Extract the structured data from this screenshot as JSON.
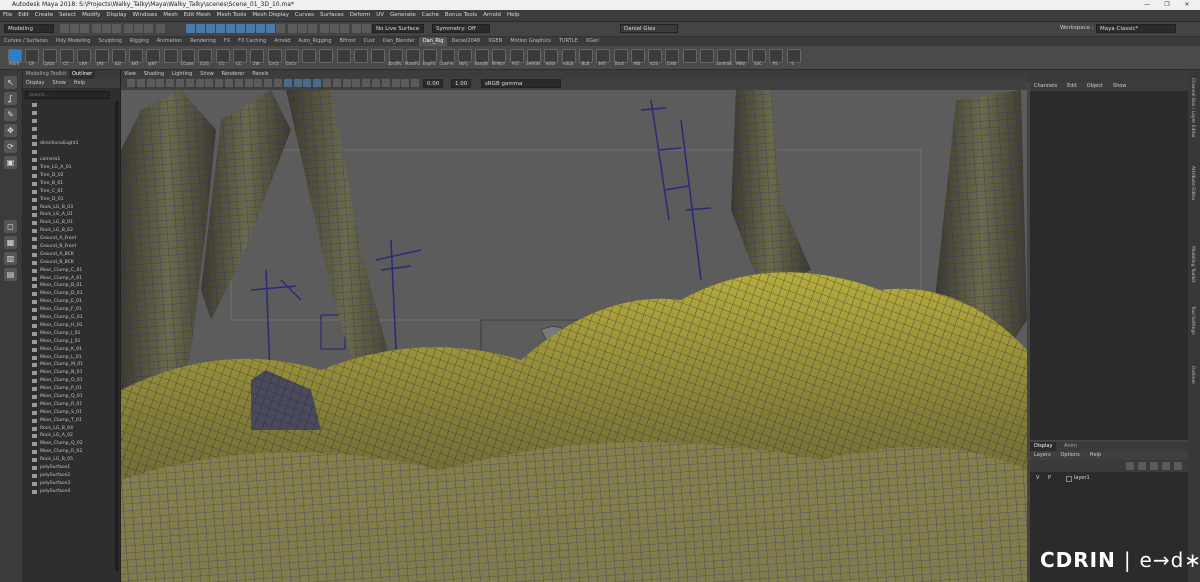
{
  "window": {
    "title": "Autodesk Maya 2018: S:\\Projects\\Walky_Talky\\Maya\\Walky_Talky\\scenes\\Scene_01_3D_10.ma*",
    "buttons": [
      "—",
      "❐",
      "✕"
    ]
  },
  "menubar": {
    "items": [
      "File",
      "Edit",
      "Create",
      "Select",
      "Modify",
      "Display",
      "Windows",
      "Mesh",
      "Edit Mesh",
      "Mesh Tools",
      "Mesh Display",
      "Curves",
      "Surfaces",
      "Deform",
      "UV",
      "Generate",
      "Cache",
      "Bonus Tools",
      "Arnold",
      "Help"
    ]
  },
  "statusline": {
    "mode": "Modeling",
    "live_surface": "No Live Surface",
    "symmetry": "Symmetry: Off",
    "user": "Daniel Gies",
    "workspace_label": "Workspace :",
    "workspace_value": "Maya Classic*"
  },
  "shelf": {
    "tabs": [
      "Curves / Surfaces",
      "Poly Modeling",
      "Sculpting",
      "Rigging",
      "Animation",
      "Rendering",
      "FX",
      "FX Caching",
      "Arnold",
      "Auto_Rigging",
      "Bifrost",
      "Cust",
      "Dan_Blender",
      "Dan_Rig",
      "Daniel2048",
      "XGEN",
      "Motion Graphics",
      "TURTLE",
      "XGen"
    ],
    "active_tab": "Dan_Rig",
    "icons": [
      {
        "label": "Anim",
        "color": "#2c7fc9"
      },
      {
        "label": "CP",
        "color": "#3b3b3b"
      },
      {
        "label": "CpGd",
        "color": "#3b3b3b"
      },
      {
        "label": "CC",
        "color": "#3b3b3b"
      },
      {
        "label": "LRA",
        "color": "#3b3b3b"
      },
      {
        "label": "JAS",
        "color": "#3b3b3b"
      },
      {
        "label": "ILB",
        "color": "#3b3b3b"
      },
      {
        "label": "EKT",
        "color": "#3b3b3b"
      },
      {
        "label": "xJNT",
        "color": "#3b3b3b"
      },
      {
        "label": "",
        "color": "#3b3b3b"
      },
      {
        "label": "CCube",
        "color": "#3b3b3b"
      },
      {
        "label": "COG",
        "color": "#3b3b3b"
      },
      {
        "label": "CC",
        "color": "#3b3b3b"
      },
      {
        "label": "CC",
        "color": "#3b3b3b"
      },
      {
        "label": "2W",
        "color": "#3b3b3b"
      },
      {
        "label": "CirCt",
        "color": "#3b3b3b"
      },
      {
        "label": "CirCs",
        "color": "#3b3b3b"
      },
      {
        "label": "",
        "color": "#3b3b3b"
      },
      {
        "label": "",
        "color": "#3b3b3b"
      },
      {
        "label": "",
        "color": "#3b3b3b"
      },
      {
        "label": "",
        "color": "#3b3b3b"
      },
      {
        "label": "",
        "color": "#3b3b3b"
      },
      {
        "label": "dbrSPL",
        "color": "#3b3b3b"
      },
      {
        "label": "MarkFG",
        "color": "#3b3b3b"
      },
      {
        "label": "ExpFG",
        "color": "#3b3b3b"
      },
      {
        "label": "ConFm",
        "color": "#3b3b3b"
      },
      {
        "label": "INFC",
        "color": "#3b3b3b"
      },
      {
        "label": "RamJN",
        "color": "#3b3b3b"
      },
      {
        "label": "RFMclr",
        "color": "#3b3b3b"
      },
      {
        "label": "PST",
        "color": "#3b3b3b"
      },
      {
        "label": "SHPGN",
        "color": "#3b3b3b"
      },
      {
        "label": "HSW",
        "color": "#3b3b3b"
      },
      {
        "label": "+BLB",
        "color": "#3b3b3b"
      },
      {
        "label": "-BLB",
        "color": "#3b3b3b"
      },
      {
        "label": "EAT",
        "color": "#3b3b3b"
      },
      {
        "label": "BlnX",
        "color": "#3b3b3b"
      },
      {
        "label": "AIB",
        "color": "#3b3b3b"
      },
      {
        "label": "K2S",
        "color": "#3b3b3b"
      },
      {
        "label": "CVW",
        "color": "#3b3b3b"
      },
      {
        "label": "",
        "color": "#3b3b3b"
      },
      {
        "label": "",
        "color": "#3b3b3b"
      },
      {
        "label": "SmthSK",
        "color": "#3b3b3b"
      },
      {
        "label": "PBW",
        "color": "#3b3b3b"
      },
      {
        "label": "SSC",
        "color": "#3b3b3b"
      },
      {
        "label": "PS",
        "color": "#3b3b3b"
      },
      {
        "label": "S",
        "color": "#3b3b3b"
      }
    ]
  },
  "outliner": {
    "tabs": [
      "Modeling Toolkit",
      "Outliner"
    ],
    "active_tab": "Outliner",
    "menu": [
      "Display",
      "Show",
      "Help"
    ],
    "search_placeholder": "Search...",
    "items": [
      {
        "name": "",
        "dim": true
      },
      {
        "name": "",
        "dim": true
      },
      {
        "name": "",
        "dim": true
      },
      {
        "name": "",
        "dim": true
      },
      {
        "name": "",
        "dim": true
      },
      {
        "name": "directionalLight1",
        "dim": false
      },
      {
        "name": "",
        "dim": true
      },
      {
        "name": "camera1",
        "dim": false
      },
      {
        "name": "Tree_LG_A_01",
        "dim": false
      },
      {
        "name": "Tree_D_02",
        "dim": false
      },
      {
        "name": "Tree_B_01",
        "dim": false
      },
      {
        "name": "Tree_C_01",
        "dim": false
      },
      {
        "name": "Tree_D_01",
        "dim": false
      },
      {
        "name": "Rock_LG_B_03",
        "dim": false
      },
      {
        "name": "Rock_LG_A_01",
        "dim": false
      },
      {
        "name": "Rock_LG_B_01",
        "dim": false
      },
      {
        "name": "Rock_LG_B_02",
        "dim": false
      },
      {
        "name": "Ground_A_Front",
        "dim": false
      },
      {
        "name": "Ground_B_Front",
        "dim": false
      },
      {
        "name": "Ground_A_BCK",
        "dim": false
      },
      {
        "name": "Ground_B_BCK",
        "dim": false
      },
      {
        "name": "Moss_Clump_C_01",
        "dim": false
      },
      {
        "name": "Moss_Clump_A_01",
        "dim": false
      },
      {
        "name": "Moss_Clump_B_01",
        "dim": false
      },
      {
        "name": "Moss_Clump_D_01",
        "dim": false
      },
      {
        "name": "Moss_Clump_E_01",
        "dim": false
      },
      {
        "name": "Moss_Clump_F_01",
        "dim": false
      },
      {
        "name": "Moss_Clump_G_01",
        "dim": false
      },
      {
        "name": "Moss_Clump_H_01",
        "dim": false
      },
      {
        "name": "Moss_Clump_I_01",
        "dim": false
      },
      {
        "name": "Moss_Clump_J_01",
        "dim": false
      },
      {
        "name": "Moss_Clump_K_01",
        "dim": false
      },
      {
        "name": "Moss_Clump_L_01",
        "dim": false
      },
      {
        "name": "Moss_Clump_M_01",
        "dim": false
      },
      {
        "name": "Moss_Clump_N_01",
        "dim": false
      },
      {
        "name": "Moss_Clump_O_01",
        "dim": false
      },
      {
        "name": "Moss_Clump_P_01",
        "dim": false
      },
      {
        "name": "Moss_Clump_Q_01",
        "dim": false
      },
      {
        "name": "Moss_Clump_R_01",
        "dim": false
      },
      {
        "name": "Moss_Clump_S_01",
        "dim": false
      },
      {
        "name": "Moss_Clump_T_01",
        "dim": false
      },
      {
        "name": "Rock_LG_B_04",
        "dim": false
      },
      {
        "name": "Rock_LG_A_02",
        "dim": false
      },
      {
        "name": "Moss_Clump_Q_02",
        "dim": false
      },
      {
        "name": "Moss_Clump_R_02",
        "dim": false
      },
      {
        "name": "Rock_LG_B_05",
        "dim": false
      },
      {
        "name": "polySurface1",
        "dim": false
      },
      {
        "name": "polySurface2",
        "dim": false
      },
      {
        "name": "polySurface3",
        "dim": false
      },
      {
        "name": "polySurface4",
        "dim": false
      }
    ]
  },
  "viewport": {
    "menu": [
      "View",
      "Shading",
      "Lighting",
      "Show",
      "Renderer",
      "Panels"
    ],
    "exposure": "0.00",
    "gamma": "1.00",
    "color_space": "sRGB gamma"
  },
  "channelbox": {
    "menu": [
      "Channels",
      "Edit",
      "Object",
      "Show"
    ]
  },
  "layers": {
    "tabs": [
      "Display",
      "Anim"
    ],
    "active_tab": "Display",
    "menu": [
      "Layers",
      "Options",
      "Help"
    ],
    "v": "V",
    "p": "P",
    "layer_name": "layer1"
  },
  "sidetabs": [
    "Channel Box / Layer Editor",
    "Attribute Editor",
    "Modeling Toolkit",
    "Tool Settings",
    "Outliner"
  ],
  "watermark": {
    "part1": "CDRIN",
    "separator": "|",
    "part2": "e→d∗"
  }
}
